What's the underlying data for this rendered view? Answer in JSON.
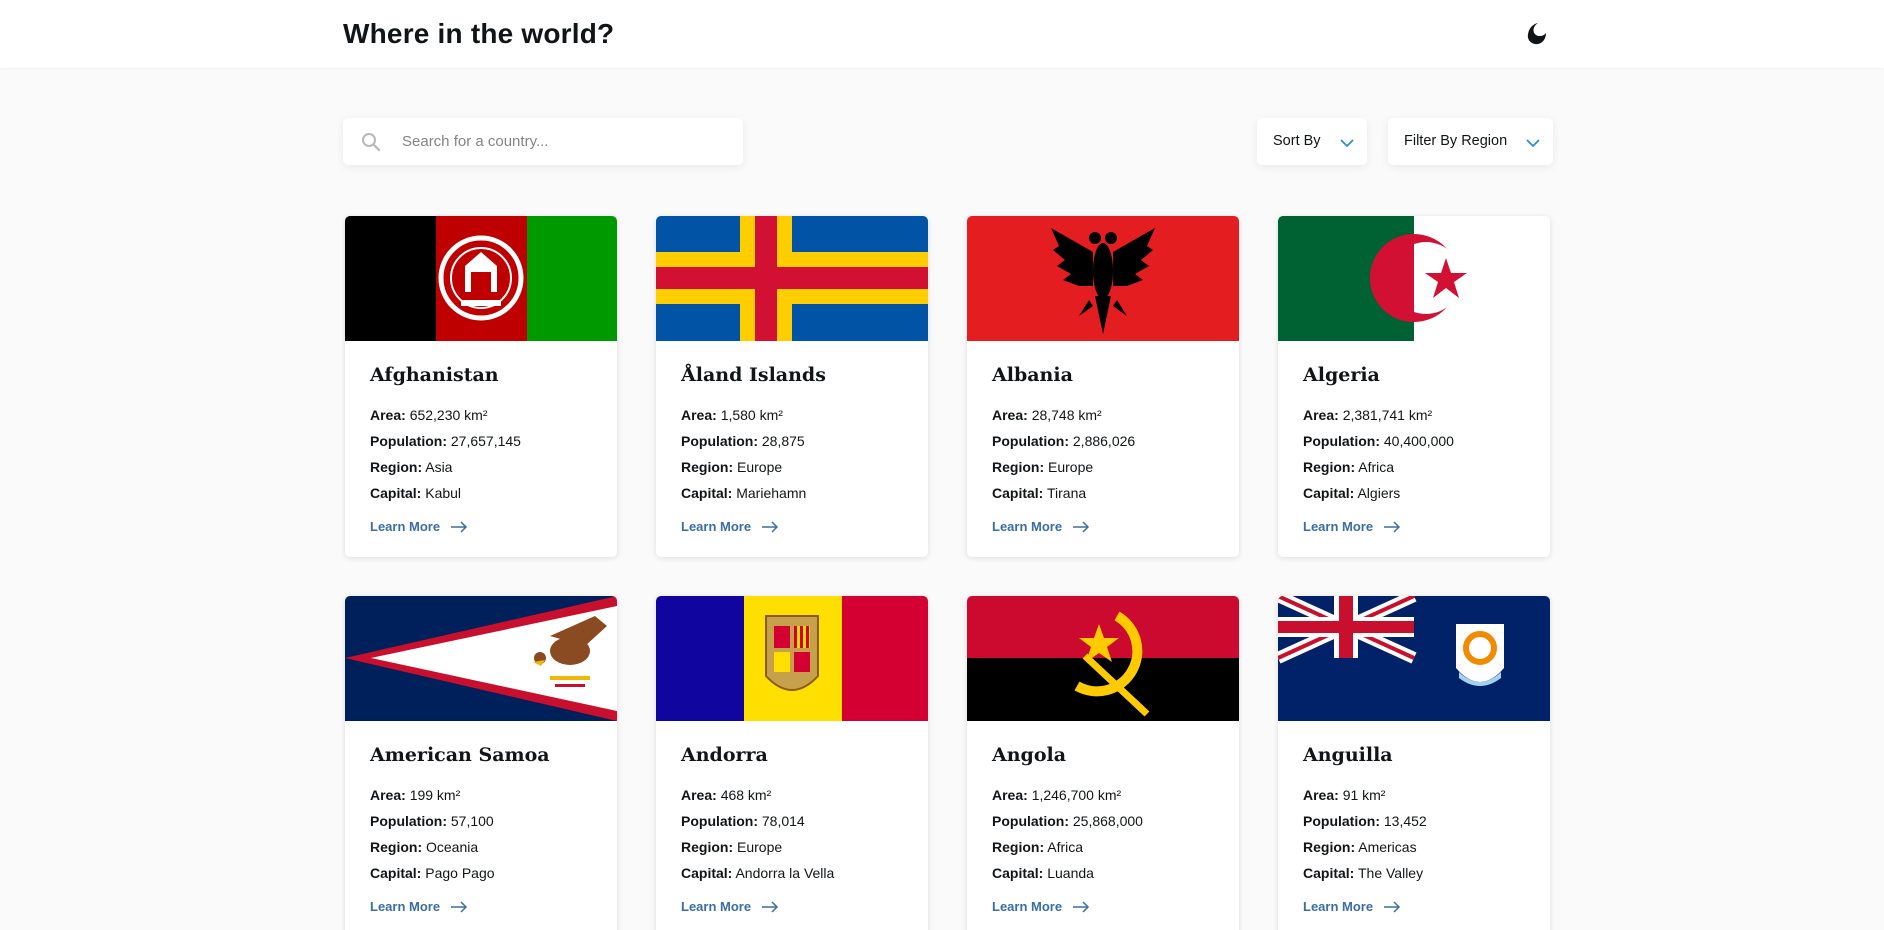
{
  "header": {
    "title": "Where in the world?",
    "theme_icon": "moon-icon"
  },
  "search": {
    "placeholder": "Search for a country...",
    "value": "",
    "icon": "search-icon"
  },
  "controls": {
    "sort_label": "Sort By",
    "filter_label": "Filter By Region"
  },
  "labels": {
    "area": "Area:",
    "population": "Population:",
    "region": "Region:",
    "capital": "Capital:",
    "learn_more": "Learn More"
  },
  "countries": [
    {
      "name": "Afghanistan",
      "area": "652,230 km²",
      "population": "27,657,145",
      "region": "Asia",
      "capital": "Kabul"
    },
    {
      "name": "Åland Islands",
      "area": "1,580 km²",
      "population": "28,875",
      "region": "Europe",
      "capital": "Mariehamn"
    },
    {
      "name": "Albania",
      "area": "28,748 km²",
      "population": "2,886,026",
      "region": "Europe",
      "capital": "Tirana"
    },
    {
      "name": "Algeria",
      "area": "2,381,741 km²",
      "population": "40,400,000",
      "region": "Africa",
      "capital": "Algiers"
    },
    {
      "name": "American Samoa",
      "area": "199 km²",
      "population": "57,100",
      "region": "Oceania",
      "capital": "Pago Pago"
    },
    {
      "name": "Andorra",
      "area": "468 km²",
      "population": "78,014",
      "region": "Europe",
      "capital": "Andorra la Vella"
    },
    {
      "name": "Angola",
      "area": "1,246,700 km²",
      "population": "25,868,000",
      "region": "Africa",
      "capital": "Luanda"
    },
    {
      "name": "Anguilla",
      "area": "91 km²",
      "population": "13,452",
      "region": "Americas",
      "capital": "The Valley"
    }
  ],
  "colors": {
    "link": "#3a6ea5",
    "chevron": "#2b8fd6",
    "page_bg": "#fafafa"
  }
}
